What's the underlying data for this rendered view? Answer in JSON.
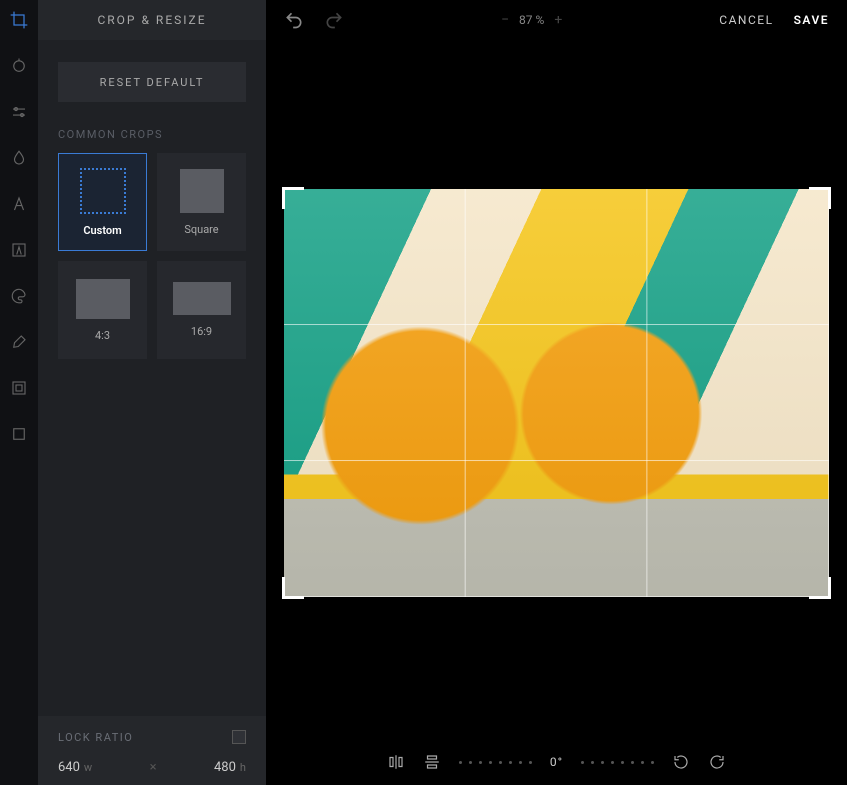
{
  "panel": {
    "title": "CROP & RESIZE",
    "reset_label": "RESET DEFAULT",
    "common_label": "COMMON CROPS",
    "crops": [
      {
        "label": "Custom",
        "selected": true
      },
      {
        "label": "Square",
        "selected": false
      },
      {
        "label": "4:3",
        "selected": false
      },
      {
        "label": "16:9",
        "selected": false
      }
    ],
    "lock_label": "LOCK RATIO",
    "lock_checked": false,
    "width_value": "640",
    "width_unit": "w",
    "height_value": "480",
    "height_unit": "h"
  },
  "topbar": {
    "zoom_value": "87 %",
    "cancel_label": "CANCEL",
    "save_label": "SAVE"
  },
  "bottombar": {
    "angle_value": "0°"
  },
  "rail_icons": [
    "crop-icon",
    "adjust-icon",
    "sliders-icon",
    "droplet-icon",
    "text-icon",
    "text2-icon",
    "palette-icon",
    "brush-icon",
    "frame-icon",
    "canvas-icon"
  ]
}
